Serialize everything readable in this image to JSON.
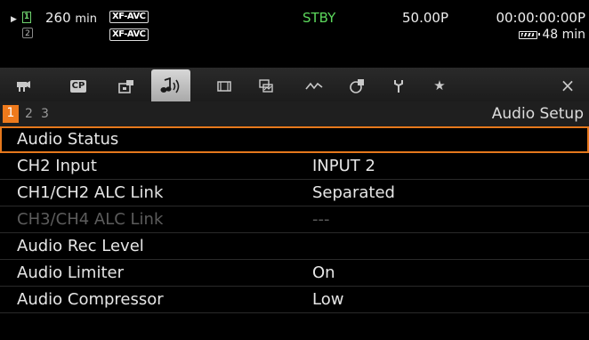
{
  "status_bar": {
    "media_remaining": "260",
    "media_remaining_unit": "min",
    "format_1": "XF-AVC",
    "format_2": "XF-AVC",
    "slot_1": "1",
    "recording_status": "STBY",
    "frame_rate": "50.00P",
    "timecode": "00:00:00:00",
    "timecode_suffix": "P",
    "battery_remaining": "48",
    "battery_unit": "min",
    "colors": {
      "standby": "#5cd85c",
      "slot": "#6fd36f"
    }
  },
  "tabs": [
    {
      "icon": "camera-setup-icon"
    },
    {
      "icon": "custom-picture-icon",
      "label": "CP"
    },
    {
      "icon": "recording-media-icon"
    },
    {
      "icon": "audio-setup-icon",
      "active": true
    },
    {
      "icon": "video-setup-icon"
    },
    {
      "icon": "lcd-vf-setup-icon"
    },
    {
      "icon": "tc-ub-setup-icon"
    },
    {
      "icon": "system-setup-icon"
    },
    {
      "icon": "wrench-icon"
    },
    {
      "icon": "my-menu-star-icon"
    },
    {
      "icon": "close-icon",
      "label": "×"
    }
  ],
  "pages": [
    "1",
    "2",
    "3"
  ],
  "active_page": "1",
  "page_title": "Audio Setup",
  "accent_color": "#ee7a1c",
  "menu": [
    {
      "label": "Audio Status",
      "value": "",
      "selected": true
    },
    {
      "label": "CH2 Input",
      "value": "INPUT 2"
    },
    {
      "label": "CH1/CH2 ALC Link",
      "value": "Separated"
    },
    {
      "label": "CH3/CH4 ALC Link",
      "value": "---",
      "disabled": true
    },
    {
      "label": "Audio Rec Level",
      "value": ""
    },
    {
      "label": "Audio Limiter",
      "value": "On"
    },
    {
      "label": "Audio Compressor",
      "value": "Low"
    }
  ]
}
